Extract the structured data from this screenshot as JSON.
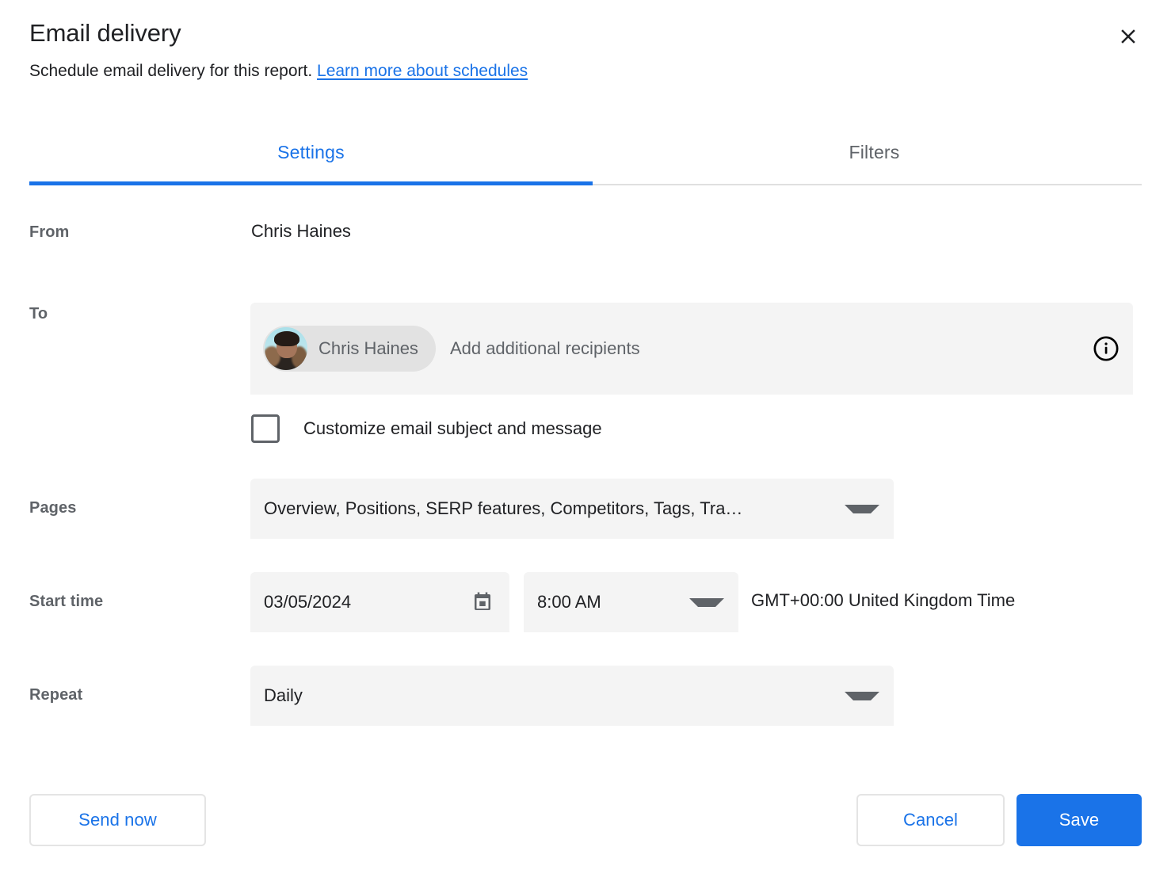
{
  "dialog": {
    "title": "Email delivery",
    "subtitle_text": "Schedule email delivery for this report.",
    "subtitle_link": "Learn more about schedules",
    "close_label": "×"
  },
  "tabs": [
    {
      "label": "Settings",
      "active": true
    },
    {
      "label": "Filters",
      "active": false
    }
  ],
  "form": {
    "from": {
      "label": "From",
      "value": "Chris Haines"
    },
    "to": {
      "label": "To",
      "chip_name": "Chris Haines",
      "placeholder": "Add additional recipients",
      "info_icon": "info-icon"
    },
    "customize": {
      "label": "Customize email subject and message",
      "checked": false
    },
    "pages": {
      "label": "Pages",
      "value": "Overview, Positions, SERP features, Competitors, Tags, Tra…"
    },
    "start_time": {
      "label": "Start time",
      "date": "03/05/2024",
      "time": "8:00 AM",
      "timezone": "GMT+00:00 United Kingdom Time"
    },
    "repeat": {
      "label": "Repeat",
      "value": "Daily"
    }
  },
  "footer": {
    "send_now": "Send now",
    "cancel": "Cancel",
    "save": "Save"
  },
  "colors": {
    "accent": "#1a73e8",
    "label": "#5f6368",
    "field_bg": "#f4f4f4",
    "chip_bg": "#e2e2e2"
  }
}
